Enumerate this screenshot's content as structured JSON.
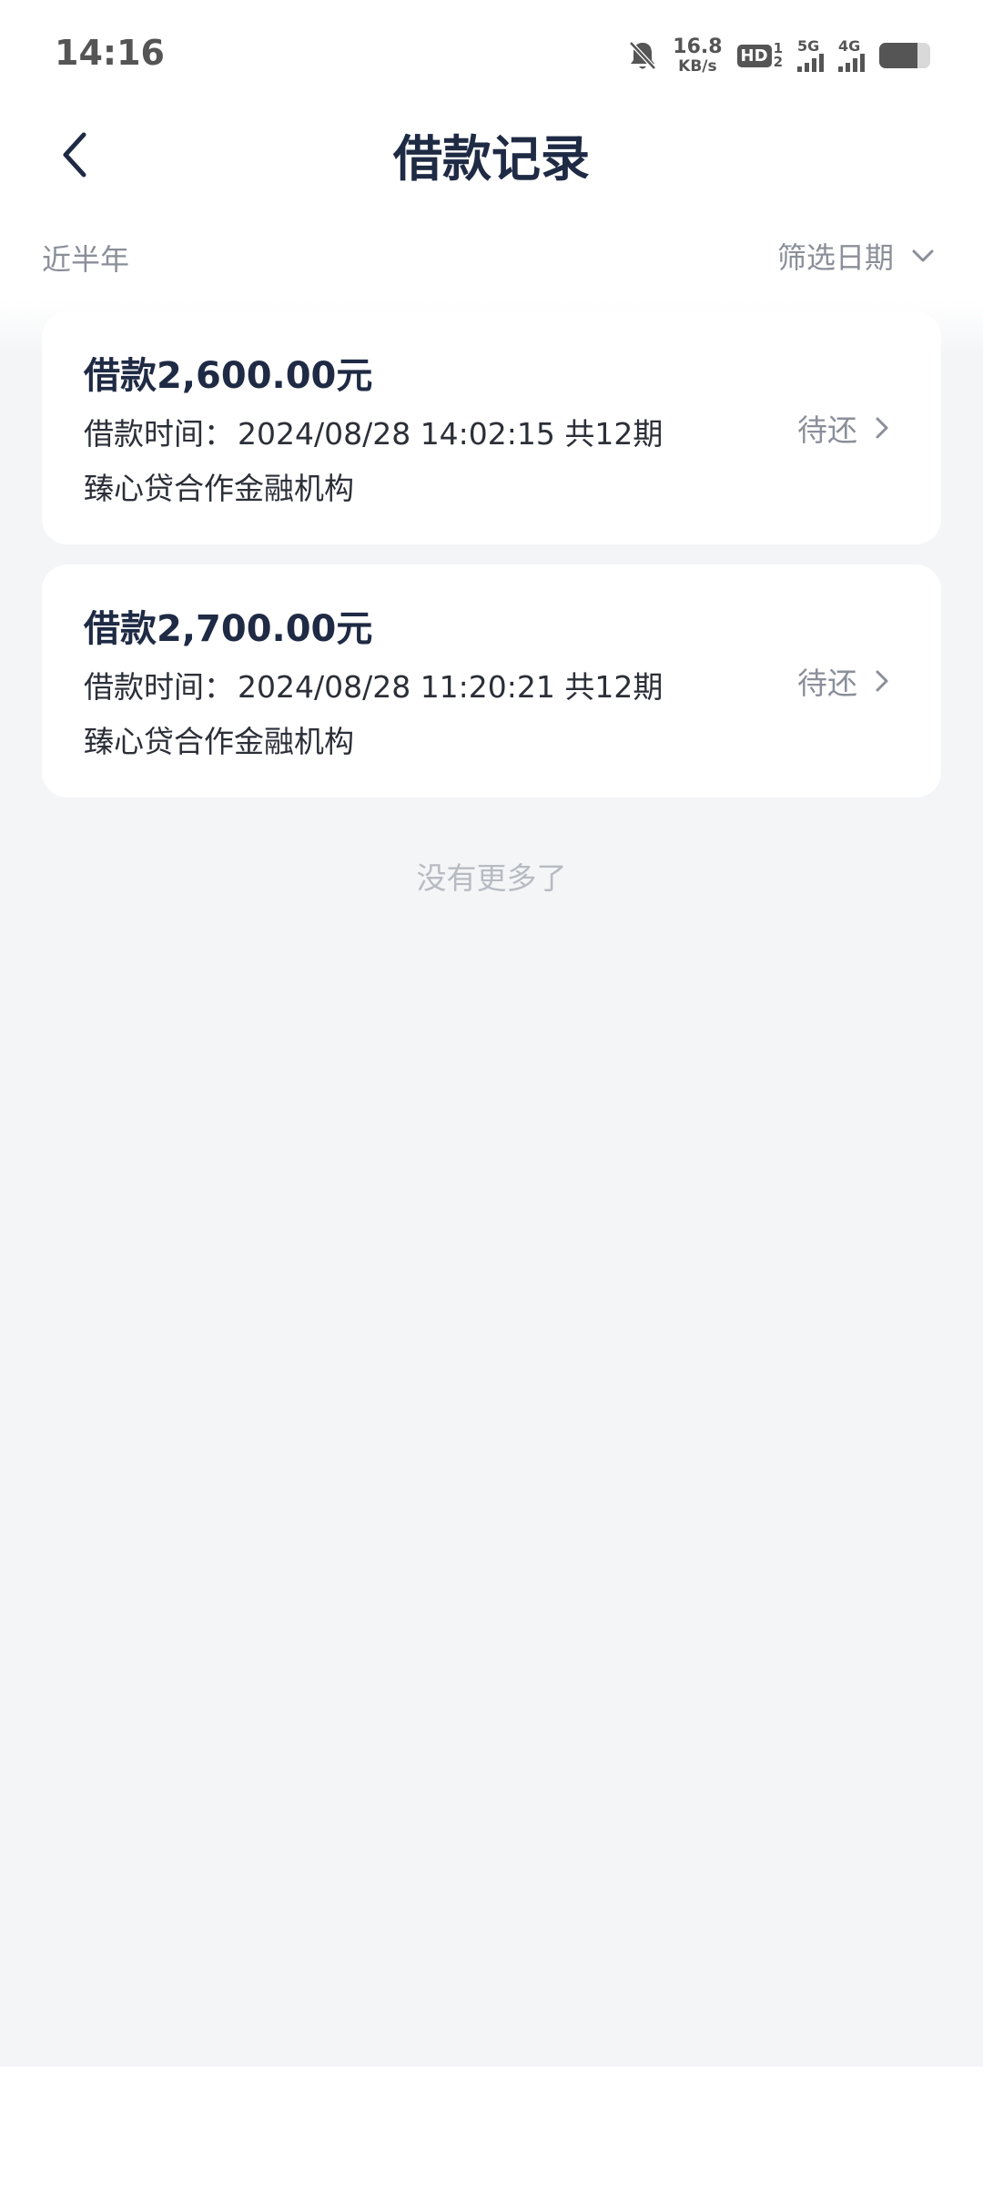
{
  "status_bar": {
    "time": "14:16",
    "net_speed_value": "16.8",
    "net_speed_unit": "KB/s",
    "hd_label": "HD",
    "hd_sub_1": "1",
    "hd_sub_2": "2",
    "signal_1_label": "5G",
    "signal_2_label": "4G",
    "battery_level": 0.75
  },
  "header": {
    "title": "借款记录"
  },
  "filter": {
    "range_label": "近半年",
    "date_filter_label": "筛选日期"
  },
  "loans": [
    {
      "amount": "借款2,600.00元",
      "time_prefix": "借款时间：",
      "time": "2024/08/28 14:02:15",
      "periods": "共12期",
      "org": "臻心贷合作金融机构",
      "status": "待还"
    },
    {
      "amount": "借款2,700.00元",
      "time_prefix": "借款时间：",
      "time": "2024/08/28 11:20:21",
      "periods": "共12期",
      "org": "臻心贷合作金融机构",
      "status": "待还"
    }
  ],
  "footer_text": "没有更多了",
  "colors": {
    "title": "#1f2a44",
    "muted": "#8a8f99",
    "background": "#f4f5f7"
  }
}
